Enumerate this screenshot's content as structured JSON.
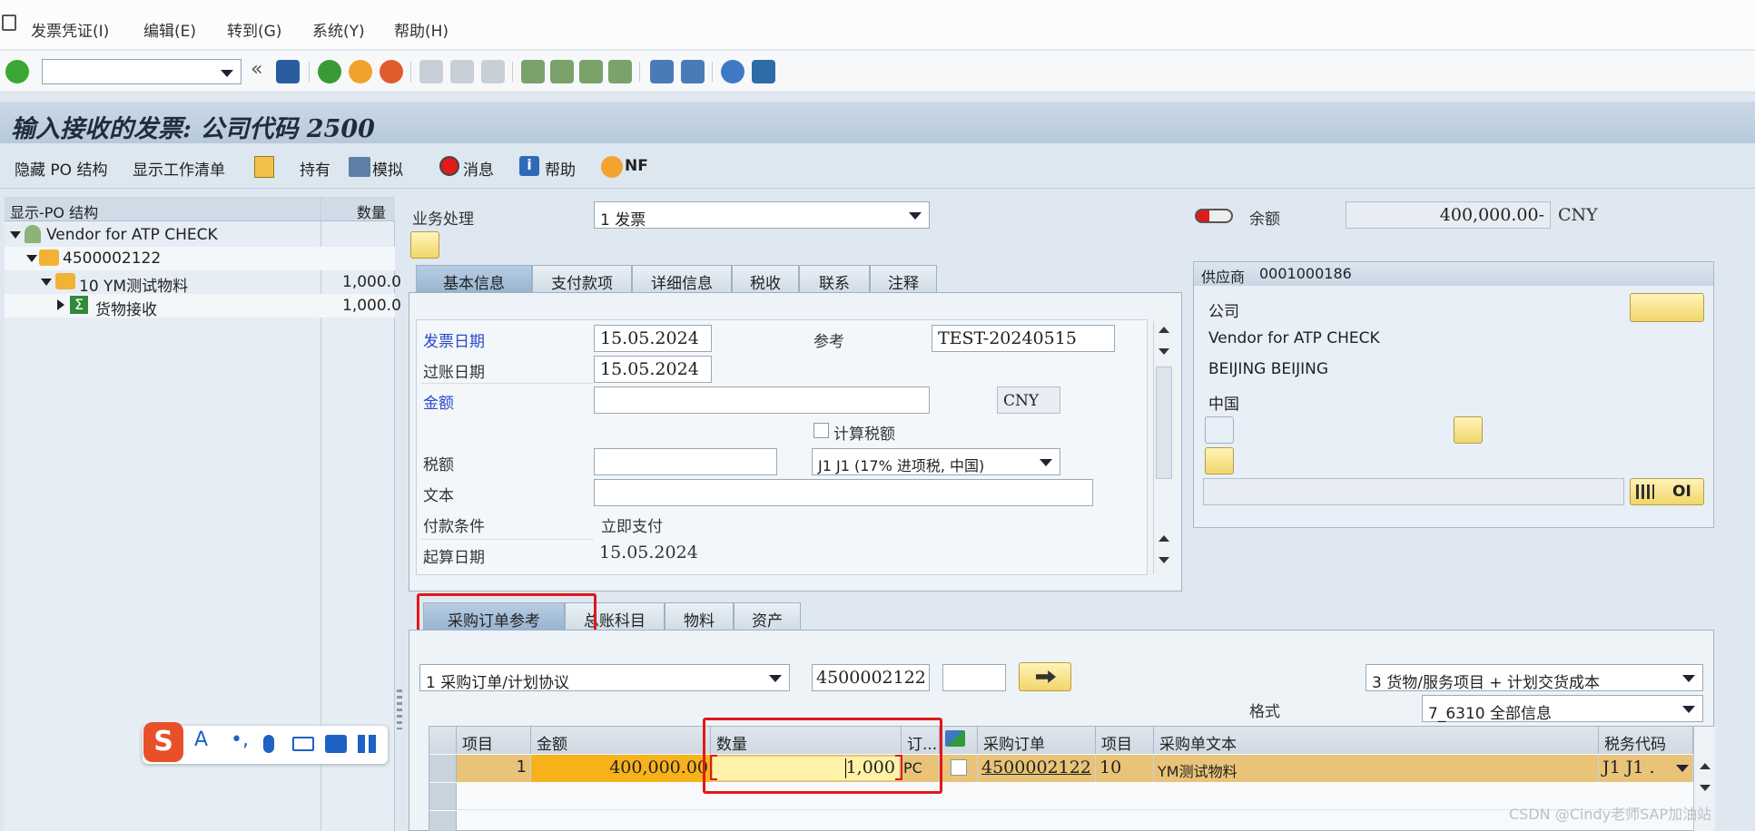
{
  "menu": [
    "发票凭证(I)",
    "编辑(E)",
    "转到(G)",
    "系统(Y)",
    "帮助(H)"
  ],
  "toolbar": {
    "command_value": "",
    "collapse_glyph": "«"
  },
  "title": "输入接收的发票: 公司代码 2500",
  "app_toolbar": {
    "hide_po": "隐藏 PO 结构",
    "worklist": "显示工作清单",
    "hold": "持有",
    "simulate": "模拟",
    "messages": "消息",
    "help": "帮助",
    "nf": "NF"
  },
  "tree": {
    "col_struct": "显示-PO 结构",
    "col_qty": "数量",
    "rows": [
      {
        "label": "Vendor for ATP CHECK",
        "qty": ""
      },
      {
        "label": "4500002122",
        "qty": ""
      },
      {
        "label": "10 YM测试物料",
        "qty": "1,000.0"
      },
      {
        "label": "货物接收",
        "qty": "1,000.0"
      }
    ]
  },
  "transaction": {
    "label": "业务处理",
    "value": "1 发票"
  },
  "balance": {
    "label": "余额",
    "value": "400,000.00-",
    "currency": "CNY"
  },
  "header_tabs": [
    "基本信息",
    "支付款项",
    "详细信息",
    "税收",
    "联系",
    "注释"
  ],
  "basic": {
    "invoice_date_label": "发票日期",
    "invoice_date": "15.05.2024",
    "reference_label": "参考",
    "reference": "TEST-20240515",
    "posting_date_label": "过账日期",
    "posting_date": "15.05.2024",
    "amount_label": "金额",
    "amount": "",
    "currency": "CNY",
    "calc_tax_label": "计算税额",
    "tax_label": "税额",
    "tax_amount": "",
    "tax_code": "J1 J1 (17% 进项税, 中国)",
    "text_label": "文本",
    "text": "",
    "payterm_label": "付款条件",
    "payterm": "立即支付",
    "baseline_label": "起算日期",
    "baseline": "15.05.2024"
  },
  "vendor": {
    "title_label": "供应商",
    "id": "0001000186",
    "company_label": "公司",
    "name": "Vendor for ATP CHECK",
    "city": "BEIJING BEIJING",
    "country": "中国",
    "oi": "OI"
  },
  "item_tabs": [
    "采购订单参考",
    "总账科目",
    "物料",
    "资产"
  ],
  "po_ref": {
    "type": "1 采购订单/计划协议",
    "po_number": "4500002122",
    "item": "",
    "layout_select": "3 货物/服务项目 + 计划交货成本",
    "format_label": "格式",
    "format": "7_6310 全部信息"
  },
  "grid": {
    "headers": [
      "项目",
      "金额",
      "数量",
      "订...",
      "",
      "采购订单",
      "项目",
      "采购单文本",
      "税务代码"
    ],
    "row": {
      "item": "1",
      "amount": "400,000.00",
      "qty": "1,000",
      "unit": "PC",
      "po": "4500002122",
      "po_item": "10",
      "text": "YM测试物料",
      "tax": "J1  J1 ."
    }
  },
  "watermark": "CSDN @Cindy老师SAP加油站",
  "colors": {
    "highlight_row": "#f3be4c",
    "red_box": "#e01818",
    "title_bg": "#b7c9da"
  }
}
